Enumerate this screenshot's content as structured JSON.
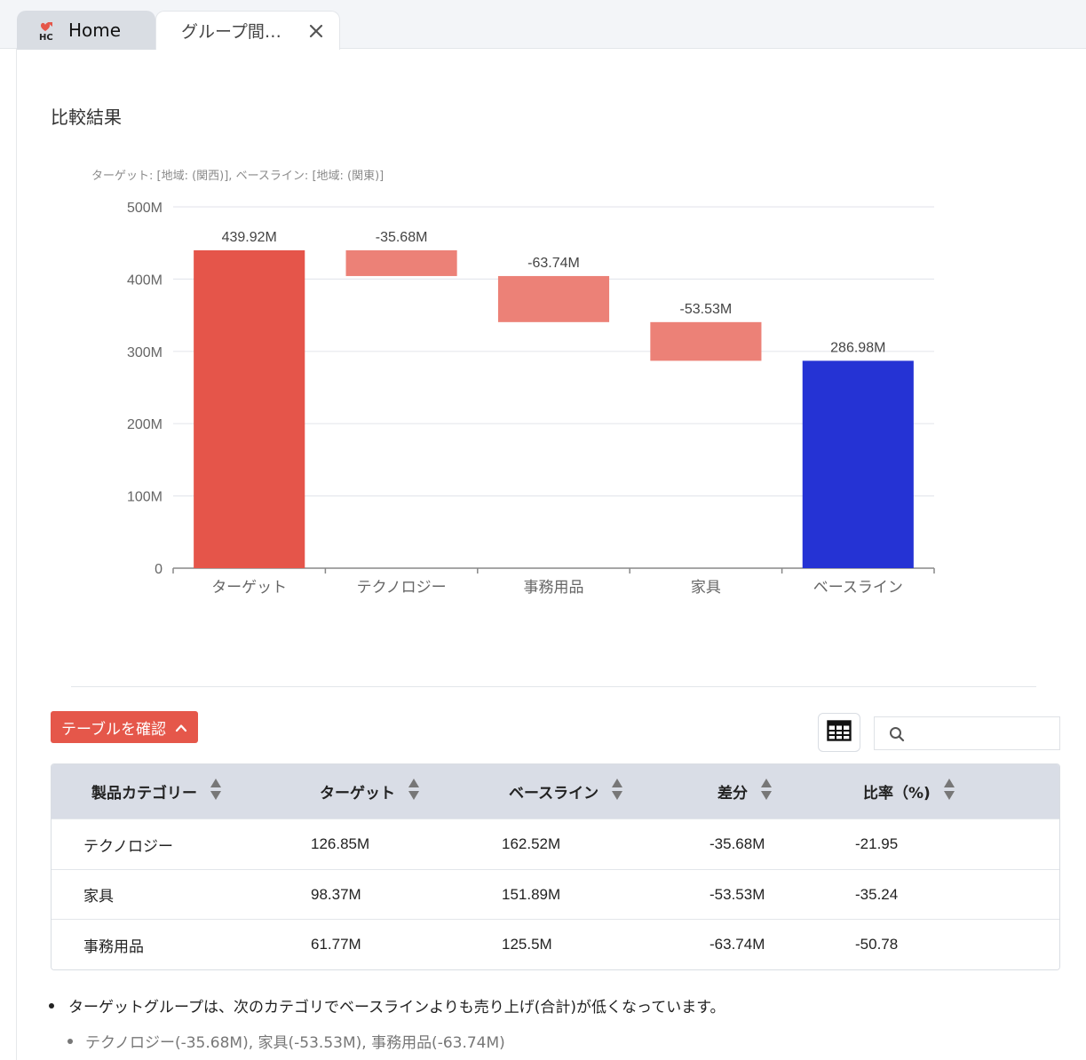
{
  "tabs": {
    "home_label": "Home",
    "active_label": "グループ間…"
  },
  "section_title": "比較結果",
  "chart_data": {
    "type": "waterfall",
    "subtitle": "ターゲット: [地域: (関西)], ベースライン: [地域: (関東)]",
    "categories": [
      "ターゲット",
      "テクノロジー",
      "事務用品",
      "家具",
      "ベースライン"
    ],
    "values": [
      439.92,
      -35.68,
      -63.74,
      -53.53,
      286.98
    ],
    "data_labels": [
      "439.92M",
      "-35.68M",
      "-63.74M",
      "-53.53M",
      "286.98M"
    ],
    "unit": "M",
    "ylim": [
      0,
      500
    ],
    "yticks": [
      0,
      100,
      200,
      300,
      400,
      500
    ],
    "ytick_labels": [
      "0",
      "100M",
      "200M",
      "300M",
      "400M",
      "500M"
    ],
    "grid": true,
    "colors": {
      "target": "#e5554a",
      "delta": "#ec8177",
      "baseline": "#2533d4"
    }
  },
  "controls": {
    "confirm_label": "テーブルを確認",
    "search_placeholder": ""
  },
  "table": {
    "headers": [
      "製品カテゴリー",
      "ターゲット",
      "ベースライン",
      "差分",
      "比率（%)"
    ],
    "rows": [
      [
        "テクノロジー",
        "126.85M",
        "162.52M",
        "-35.68M",
        "-21.95"
      ],
      [
        "家具",
        "98.37M",
        "151.89M",
        "-53.53M",
        "-35.24"
      ],
      [
        "事務用品",
        "61.77M",
        "125.5M",
        "-63.74M",
        "-50.78"
      ]
    ]
  },
  "notes": {
    "main": "ターゲットグループは、次のカテゴリでベースラインよりも売り上げ(合計)が低くなっています。",
    "sub": "テクノロジー(-35.68M), 家具(-53.53M), 事務用品(-63.74M)"
  },
  "colors": {
    "accent": "#e5574a",
    "header_bg": "#d9dde6"
  }
}
